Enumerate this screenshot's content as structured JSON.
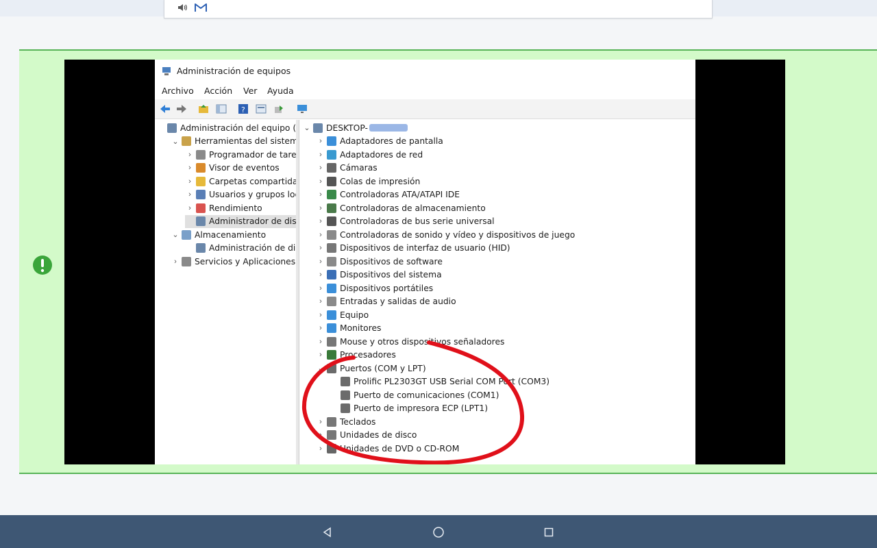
{
  "colors": {
    "accent_red": "#e0101a",
    "band_green": "#d3fac9",
    "band_border": "#57b457",
    "nav_bg": "#3e5774"
  },
  "top_bar": {
    "icons": [
      "speaker-icon",
      "gmail-icon"
    ]
  },
  "window": {
    "title": "Administración de equipos",
    "menu": [
      "Archivo",
      "Acción",
      "Ver",
      "Ayuda"
    ],
    "toolbar_icons": [
      "back-icon",
      "forward-icon",
      "up-folder-icon",
      "show-hide-tree-icon",
      "help-icon",
      "properties-icon",
      "export-icon",
      "monitor-icon"
    ],
    "left_tree": [
      {
        "label": "Administración del equipo (loc",
        "icon": "computer-management-icon",
        "level": 0,
        "expander": ""
      },
      {
        "label": "Herramientas del sistema",
        "icon": "tools-icon",
        "level": 1,
        "expander": "v"
      },
      {
        "label": "Programador de tareas",
        "icon": "clock-icon",
        "level": 2,
        "expander": ">"
      },
      {
        "label": "Visor de eventos",
        "icon": "event-viewer-icon",
        "level": 2,
        "expander": ">"
      },
      {
        "label": "Carpetas compartidas",
        "icon": "shared-folder-icon",
        "level": 2,
        "expander": ">"
      },
      {
        "label": "Usuarios y grupos locale",
        "icon": "users-icon",
        "level": 2,
        "expander": ">"
      },
      {
        "label": "Rendimiento",
        "icon": "performance-icon",
        "level": 2,
        "expander": ">"
      },
      {
        "label": "Administrador de dispo",
        "icon": "device-manager-icon",
        "level": 2,
        "expander": "",
        "selected": true
      },
      {
        "label": "Almacenamiento",
        "icon": "storage-icon",
        "level": 1,
        "expander": "v"
      },
      {
        "label": "Administración de disco",
        "icon": "disk-management-icon",
        "level": 2,
        "expander": ""
      },
      {
        "label": "Servicios y Aplicaciones",
        "icon": "services-icon",
        "level": 1,
        "expander": ">"
      }
    ],
    "right_tree": {
      "root": "DESKTOP-",
      "categories": [
        {
          "label": "Adaptadores de pantalla",
          "icon": "display-adapter-icon"
        },
        {
          "label": "Adaptadores de red",
          "icon": "network-adapter-icon"
        },
        {
          "label": "Cámaras",
          "icon": "camera-icon"
        },
        {
          "label": "Colas de impresión",
          "icon": "print-queue-icon"
        },
        {
          "label": "Controladoras ATA/ATAPI IDE",
          "icon": "ide-controller-icon"
        },
        {
          "label": "Controladoras de almacenamiento",
          "icon": "storage-controller-icon"
        },
        {
          "label": "Controladoras de bus serie universal",
          "icon": "usb-icon"
        },
        {
          "label": "Controladoras de sonido y vídeo y dispositivos de juego",
          "icon": "sound-icon"
        },
        {
          "label": "Dispositivos de interfaz de usuario (HID)",
          "icon": "hid-icon"
        },
        {
          "label": "Dispositivos de software",
          "icon": "software-device-icon"
        },
        {
          "label": "Dispositivos del sistema",
          "icon": "system-device-icon"
        },
        {
          "label": "Dispositivos portátiles",
          "icon": "portable-device-icon"
        },
        {
          "label": "Entradas y salidas de audio",
          "icon": "audio-io-icon"
        },
        {
          "label": "Equipo",
          "icon": "computer-icon"
        },
        {
          "label": "Monitores",
          "icon": "monitor-icon"
        },
        {
          "label": "Mouse y otros dispositivos señaladores",
          "icon": "mouse-icon"
        },
        {
          "label": "Procesadores",
          "icon": "processor-icon"
        },
        {
          "label": "Puertos (COM y LPT)",
          "icon": "port-icon",
          "expanded": true
        },
        {
          "label": "Prolific PL2303GT USB Serial COM Port (COM3)",
          "icon": "port-icon",
          "child": true
        },
        {
          "label": "Puerto de comunicaciones (COM1)",
          "icon": "port-icon",
          "child": true
        },
        {
          "label": "Puerto de impresora ECP (LPT1)",
          "icon": "port-icon",
          "child": true
        },
        {
          "label": "Teclados",
          "icon": "keyboard-icon"
        },
        {
          "label": "Unidades de disco",
          "icon": "disk-drive-icon"
        },
        {
          "label": "Unidades de DVD o CD-ROM",
          "icon": "dvd-icon"
        }
      ]
    }
  },
  "nav": {
    "buttons": [
      "back-triangle-icon",
      "home-circle-icon",
      "recents-square-icon"
    ]
  }
}
